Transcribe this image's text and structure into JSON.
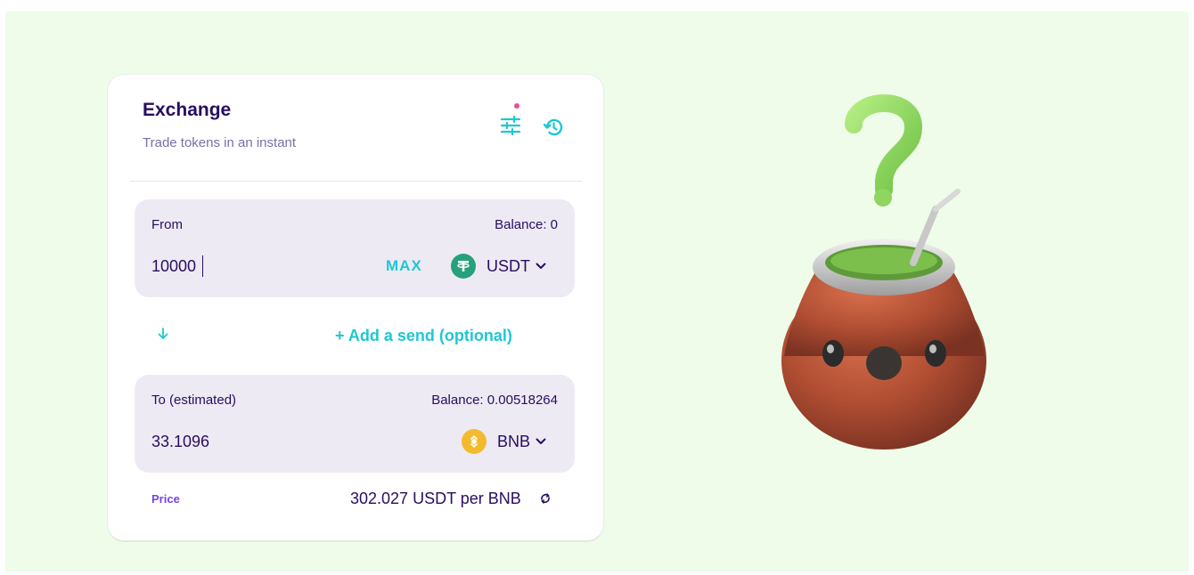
{
  "exchange": {
    "title": "Exchange",
    "subtitle": "Trade tokens in an instant"
  },
  "from": {
    "label": "From",
    "balance": "Balance: 0",
    "amount": "10000",
    "max_label": "MAX",
    "token": "USDT",
    "token_icon": "usdt-logo-icon"
  },
  "add_send": "+ Add a send (optional)",
  "to": {
    "label": "To (estimated)",
    "balance": "Balance: 0.00518264",
    "amount": "33.1096",
    "token": "BNB",
    "token_icon": "bnb-logo-icon"
  },
  "price": {
    "label": "Price",
    "value": "302.027 USDT per BNB"
  },
  "colors": {
    "background": "#effcea",
    "primary_text": "#280d5f",
    "accent": "#1fc7d4",
    "secondary": "#7645d9",
    "notification_dot": "#ed4b9e"
  }
}
